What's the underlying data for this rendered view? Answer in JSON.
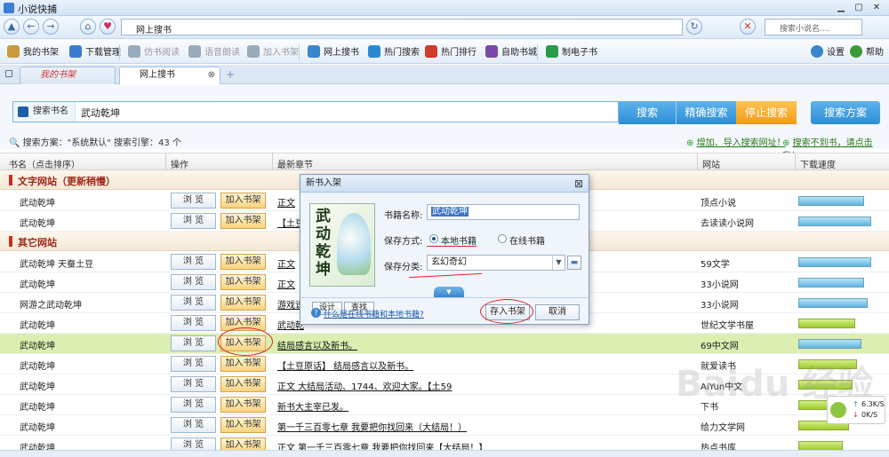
{
  "window": {
    "title": "小说快捕"
  },
  "nav": {
    "address": "网上搜书",
    "search_placeholder": "搜索小说名...."
  },
  "toolbar": {
    "items": [
      {
        "label": "我的书架",
        "enabled": true
      },
      {
        "label": "下载管理",
        "enabled": true
      },
      {
        "label": "仿书阅读",
        "enabled": false
      },
      {
        "label": "语音朗读",
        "enabled": false
      },
      {
        "label": "加入书架",
        "enabled": false
      },
      {
        "label": "网上搜书",
        "enabled": true
      },
      {
        "label": "热门搜索",
        "enabled": true
      },
      {
        "label": "热门排行",
        "enabled": true
      },
      {
        "label": "自助书城",
        "enabled": true
      },
      {
        "label": "制电子书",
        "enabled": true
      }
    ],
    "settings": "设置",
    "help": "帮助"
  },
  "tabs": [
    {
      "label": "我的书架"
    },
    {
      "label": "网上搜书"
    }
  ],
  "search": {
    "label": "搜索书名",
    "value": "武动乾坤",
    "btn_search": "搜索",
    "btn_exact": "精确搜索",
    "btn_stop": "停止搜索",
    "btn_plan": "搜索方案"
  },
  "info": {
    "plan": "搜索方案：\"系统默认\"  搜索引擎：43 个",
    "link_add": "增加、导入搜索网址！",
    "link_notfound": "搜索不到书，请点击我！"
  },
  "table": {
    "headers": [
      "书名（点击排序）",
      "操作",
      "最新章节",
      "网站",
      "下载速度"
    ],
    "browse_label": "浏 览",
    "add_label": "加入书架",
    "groups": [
      {
        "title": "文字网站（更新稍慢）",
        "rows": [
          {
            "name": "武动乾坤",
            "chapter": "正文",
            "site": "顶点小说",
            "speed": 0.88
          },
          {
            "name": "武动乾坤",
            "chapter": "【土豆",
            "site": "去读读小说网",
            "speed": 0.98
          }
        ]
      },
      {
        "title": "其它网站",
        "rows": [
          {
            "name": "武动乾坤 天蚕土豆",
            "chapter": "正文",
            "site": "59文学",
            "speed": 0.98
          },
          {
            "name": "武动乾坤",
            "chapter": "正文",
            "site": "33小说网",
            "speed": 0.88
          },
          {
            "name": "网游之武动乾坤",
            "chapter": "游戏说",
            "site": "33小说网",
            "speed": 0.93
          },
          {
            "name": "武动乾坤",
            "chapter": "武动乾",
            "site": "世纪文学书屋",
            "speed": 0.76
          },
          {
            "name": "武动乾坤",
            "chapter": "结局感言以及新书。",
            "site": "69中文网",
            "speed": 0.85
          },
          {
            "name": "武动乾坤",
            "chapter": "【土豆原话】 结局感言以及新书。",
            "site": "就爱读书",
            "speed": 0.79
          },
          {
            "name": "武动乾坤",
            "chapter": "正文  大结局活动、1744、欢迎大家。【土59",
            "site": "AiYun中文",
            "speed": 0.73
          },
          {
            "name": "武动乾坤",
            "chapter": "新书大主宰已发。",
            "site": "下书",
            "speed": 0.7
          },
          {
            "name": "武动乾坤",
            "chapter": "第一千三百零七章 我要把你找回来（大结局！）",
            "site": "给力文学网",
            "speed": 0.68
          },
          {
            "name": "武动乾坤",
            "chapter": "正文  第一千三百零七章 我要把你找回来【大结局！】",
            "site": "热点书库",
            "speed": 0.6
          }
        ]
      }
    ]
  },
  "dialog": {
    "title": "新书入架",
    "cover_text": "武动乾坤",
    "btn_design": "设计",
    "btn_find": "查找",
    "lbl_name": "书籍名称:",
    "name_value": "武动乾坤",
    "lbl_save": "保存方式:",
    "opt_local": "本地书籍",
    "opt_online": "在线书籍",
    "lbl_category": "保存分类:",
    "category_value": "玄幻奇幻",
    "help_link": "什么是在线书籍和本地书籍?",
    "btn_save": "存入书架",
    "btn_cancel": "取消"
  },
  "speed": {
    "up": "6.3K/S",
    "down": "0K/S"
  },
  "watermark": "Baidu 经验"
}
